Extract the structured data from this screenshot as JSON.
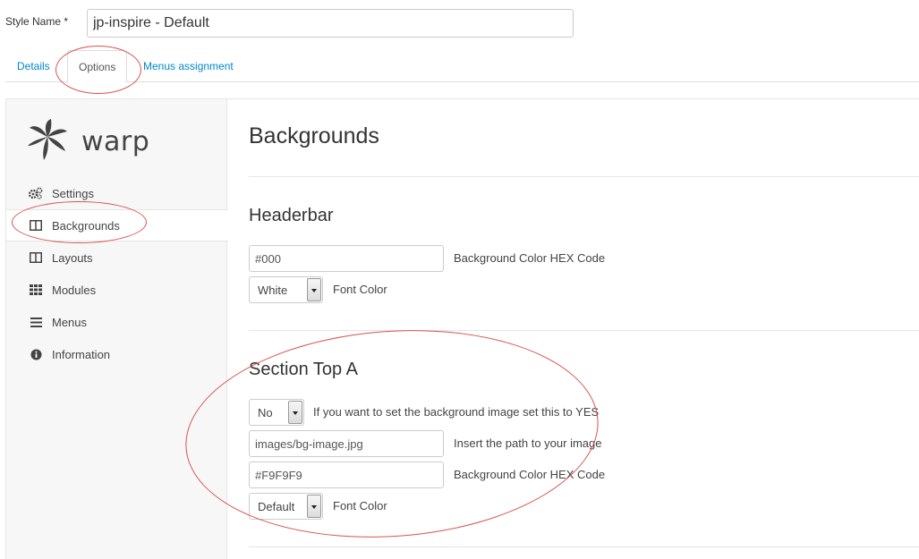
{
  "style_name": {
    "label": "Style Name *",
    "value": "jp-inspire - Default"
  },
  "tabs": [
    {
      "label": "Details",
      "active": false
    },
    {
      "label": "Options",
      "active": true
    },
    {
      "label": "Menus assignment",
      "active": false
    }
  ],
  "logo": {
    "text": "warp",
    "icon": "warp-leaf-icon"
  },
  "sidebar": {
    "items": [
      {
        "label": "Settings",
        "icon": "cogs-icon",
        "active": false
      },
      {
        "label": "Backgrounds",
        "icon": "columns-icon",
        "active": true
      },
      {
        "label": "Layouts",
        "icon": "columns-icon",
        "active": false
      },
      {
        "label": "Modules",
        "icon": "grid-icon",
        "active": false
      },
      {
        "label": "Menus",
        "icon": "list-icon",
        "active": false
      },
      {
        "label": "Information",
        "icon": "info-icon",
        "active": false
      }
    ]
  },
  "content": {
    "title": "Backgrounds",
    "headerbar": {
      "title": "Headerbar",
      "bg_color_value": "#000",
      "bg_color_label": "Background Color HEX Code",
      "font_color_value": "White",
      "font_color_label": "Font Color"
    },
    "section_top_a": {
      "title": "Section Top A",
      "bg_image_toggle_value": "No",
      "bg_image_toggle_label": "If you want to set the background image set this to YES",
      "image_path_value": "images/bg-image.jpg",
      "image_path_label": "Insert the path to your image",
      "bg_color_value": "#F9F9F9",
      "bg_color_label": "Background Color HEX Code",
      "font_color_value": "Default",
      "font_color_label": "Font Color"
    }
  },
  "colors": {
    "link": "#0088cc",
    "annotation": "#d9534f"
  }
}
